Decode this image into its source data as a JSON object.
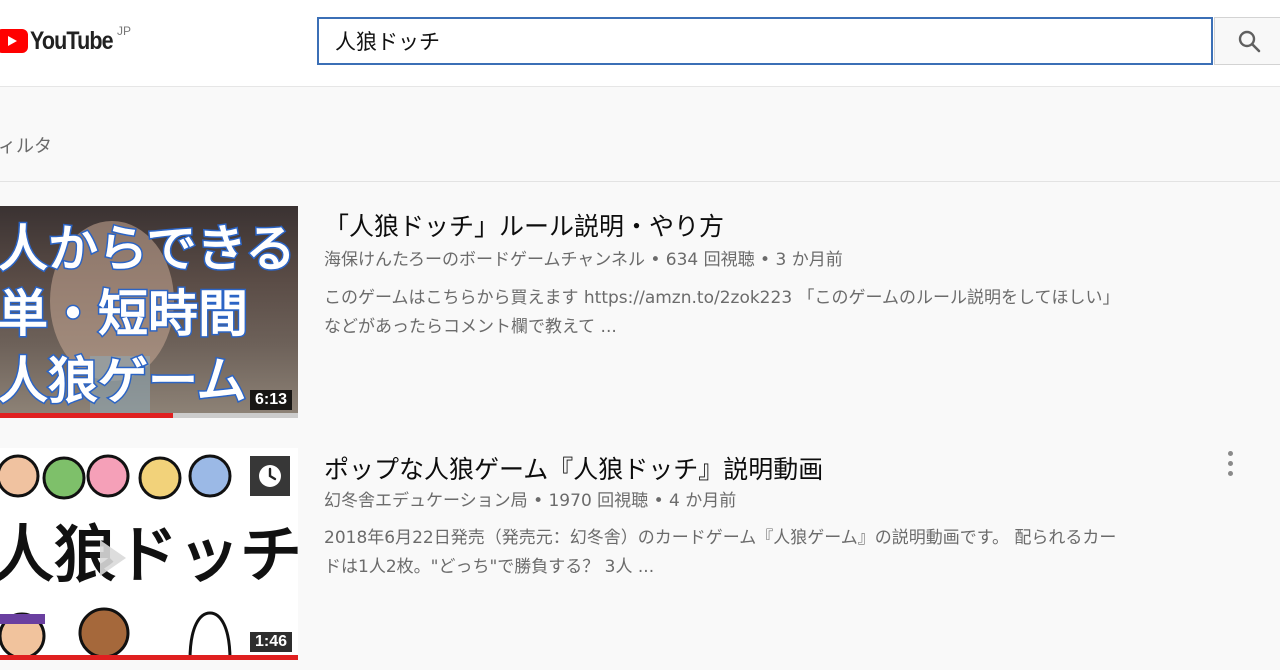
{
  "header": {
    "logo_text": "YouTube",
    "region": "JP",
    "search_value": "人狼ドッチ"
  },
  "filter": {
    "label": "ィルタ"
  },
  "results": [
    {
      "thumb_lines": [
        "人からできる",
        "単・短時間",
        "人狼ゲーム"
      ],
      "duration": "6:13",
      "progress": 0.58,
      "title": "「人狼ドッチ」ルール説明・やり方",
      "meta": "海保けんたろーのボードゲームチャンネル • 634 回視聴 • 3 か月前",
      "desc_line1": "このゲームはこちらから買えます https://amzn.to/2zok223 「このゲームのルール説明をしてほしい」",
      "desc_line2": "などがあったらコメント欄で教えて ..."
    },
    {
      "thumb_text": "人狼ドッチ",
      "duration": "1:46",
      "progress": 1.0,
      "title": "ポップな人狼ゲーム『人狼ドッチ』説明動画",
      "meta": "幻冬舎エデュケーション局 • 1970 回視聴 • 4 か月前",
      "desc_line1": "2018年6月22日発売（発売元：幻冬舎）のカードゲーム『人狼ゲーム』の説明動画です。 配られるカー",
      "desc_line2": "ドは1人2枚。\"どっち\"で勝負する？ 3人 ..."
    }
  ],
  "colors": {
    "accent": "#ff0000",
    "search_border": "#3b6fb6",
    "progress": "#e02020"
  }
}
